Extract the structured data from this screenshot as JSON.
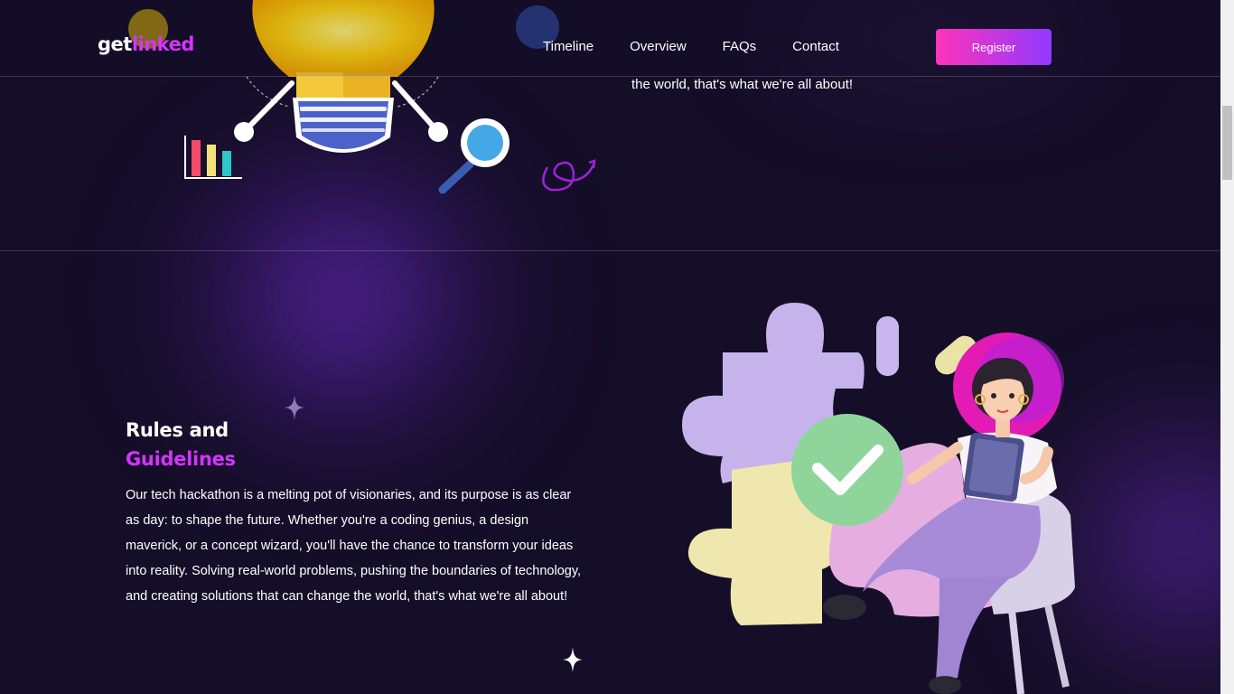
{
  "header": {
    "logo_part1": "get",
    "logo_part2": "linked",
    "nav": [
      "Timeline",
      "Overview",
      "FAQs",
      "Contact"
    ],
    "register_label": "Register"
  },
  "top_section": {
    "trailing_text": "the world, that's what we're all about!"
  },
  "rules": {
    "title_line1": "Rules and",
    "title_line2": "Guidelines",
    "body": "Our tech hackathon is a melting pot of visionaries, and its purpose is as clear as day: to shape the future. Whether you're a coding genius, a design maverick, or a concept wizard, you'll have the chance to transform your ideas into reality. Solving real-world problems, pushing the boundaries of technology, and creating solutions that can change the world, that's what we're all about!"
  },
  "colors": {
    "background": "#150e28",
    "accent": "#d434fe",
    "button_gradient_start": "#fe34b9",
    "button_gradient_end": "#903aff"
  },
  "icons": [
    "lightbulb-icon",
    "bar-chart-icon",
    "magnifier-icon",
    "swirl-arrow-icon",
    "sparkle-star-icon",
    "puzzle-illustration",
    "checkmark-icon",
    "woman-with-tablet-illustration"
  ]
}
